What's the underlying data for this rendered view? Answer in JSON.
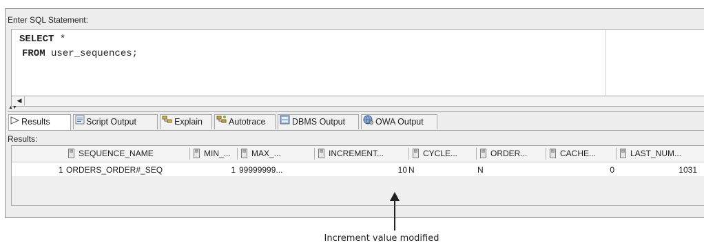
{
  "editor": {
    "label": "Enter SQL Statement:",
    "line1_kw": "SELECT",
    "line1_rest": " *",
    "line2_kw": "FROM",
    "line2_rest": " user_sequences;"
  },
  "splitter": {
    "arrows": "▲▼"
  },
  "tabs": [
    {
      "label": "Results",
      "icon": "play-triangle-icon"
    },
    {
      "label": "Script Output",
      "icon": "script-icon"
    },
    {
      "label": "Explain",
      "icon": "explain-plan-icon"
    },
    {
      "label": "Autotrace",
      "icon": "autotrace-icon"
    },
    {
      "label": "DBMS Output",
      "icon": "dbms-output-icon"
    },
    {
      "label": "OWA Output",
      "icon": "owa-output-icon"
    }
  ],
  "results": {
    "label": "Results:",
    "columns": [
      "SEQUENCE_NAME",
      "MIN_...",
      "MAX_...",
      "INCREMENT...",
      "CYCLE...",
      "ORDER...",
      "CACHE...",
      "LAST_NUM..."
    ],
    "rows": [
      {
        "rownum": "1",
        "cells": [
          "ORDERS_ORDER#_SEQ",
          "1",
          "99999999...",
          "10",
          "N",
          "N",
          "0",
          "1031"
        ]
      }
    ]
  },
  "annotation": {
    "text": "Increment value modified"
  },
  "colors": {
    "accent": "#2a6fbf",
    "window_bg": "#ededed"
  }
}
